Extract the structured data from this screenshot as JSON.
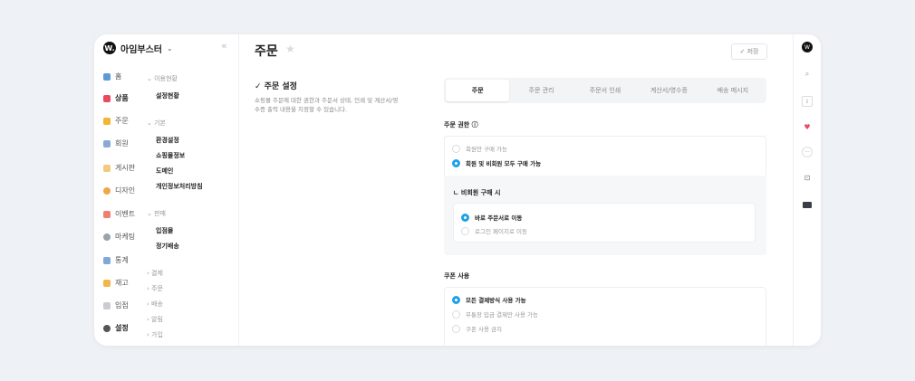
{
  "brand": {
    "logo": "W.",
    "name": "아임부스터",
    "caret": "⌄",
    "collapse": "«"
  },
  "sidebar": {
    "nav": [
      {
        "label": "홈",
        "icon": "home-icon",
        "color": "#5b9bd5"
      },
      {
        "label": "상품",
        "icon": "bag-icon",
        "color": "#e84a5f"
      },
      {
        "label": "주문",
        "icon": "order-icon",
        "color": "#f2b632"
      },
      {
        "label": "회원",
        "icon": "member-icon",
        "color": "#8aa9d6"
      },
      {
        "label": "게시판",
        "icon": "board-icon",
        "color": "#f3c97a"
      },
      {
        "label": "디자인",
        "icon": "design-icon",
        "color": "#f0a648"
      },
      {
        "label": "이벤트",
        "icon": "event-icon",
        "color": "#ef7f6d"
      },
      {
        "label": "마케팅",
        "icon": "heart-icon",
        "color": "#9aa3ad"
      },
      {
        "label": "통계",
        "icon": "stats-icon",
        "color": "#7fa7d8"
      },
      {
        "label": "재고",
        "icon": "stock-icon",
        "color": "#f0b84a"
      },
      {
        "label": "입점",
        "icon": "flag-icon",
        "color": "#c9ccd1"
      },
      {
        "label": "설정",
        "icon": "gear-icon",
        "color": "#555555"
      }
    ],
    "groups": {
      "g1": "⌄ 이용현황",
      "g1_items": [
        "설정현황"
      ],
      "g2": "⌄ 기본",
      "g2_items": [
        "환경설정",
        "쇼핑몰정보",
        "도메인",
        "개인정보처리방침"
      ],
      "g3": "⌄ 판매",
      "g3_items": [
        "입점몰",
        "정기배송"
      ],
      "collapsed": [
        "› 결제",
        "› 주문",
        "› 배송",
        "› 알림",
        "› 가입"
      ]
    }
  },
  "header": {
    "title": "주문",
    "star": "★",
    "save": "✓ 저장"
  },
  "section": {
    "title": "✓ 주문 설정",
    "desc": "쇼핑몰 주문에 대한 권한과 주문서 상태, 인쇄 및 계산서/영수증 출력 내용을 지정할 수 있습니다."
  },
  "tabs": [
    "주문",
    "주문 관리",
    "주문서 인쇄",
    "계산서/영수증",
    "배송 메시지"
  ],
  "order_permission": {
    "label": "주문 권한 ⓘ",
    "options": [
      "회원만 구매 가능",
      "회원 및 비회원 모두 구매 가능"
    ],
    "selected": 1,
    "guest_title": "ㄴ 비회원 구매 시",
    "guest_options": [
      "바로 주문서로 이동",
      "로그인 페이지로 이동"
    ],
    "guest_selected": 0
  },
  "coupon": {
    "label": "쿠폰 사용",
    "options": [
      "모든 결제방식 사용 가능",
      "무통장 입금 결제만 사용 가능",
      "쿠폰 사용 금지"
    ],
    "selected": 0
  },
  "rail": [
    "user-avatar-icon",
    "search-icon",
    "info-icon",
    "heart-icon",
    "more-icon",
    "cart-icon",
    "monitor-icon"
  ],
  "accent": "#1fa1e6"
}
